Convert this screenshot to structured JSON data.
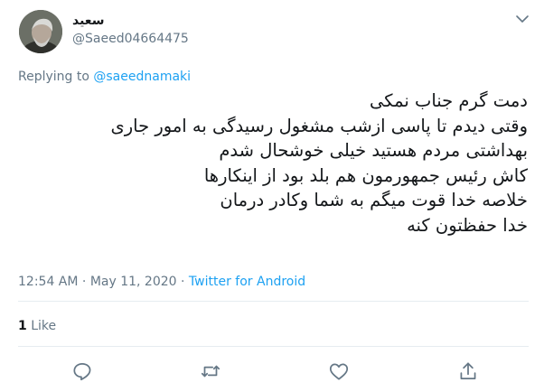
{
  "author": {
    "display_name": "سعید",
    "handle": "@Saeed04664475"
  },
  "reply": {
    "prefix": "Replying to",
    "to": "@saeednamaki"
  },
  "tweet": {
    "lines": [
      "دمت گرم جناب نمکی",
      "وقتی دیدم تا پاسی ازشب مشغول رسیدگی به امور جاری",
      "بهداشتی مردم هستید خیلی خوشحال شدم",
      "کاش رئیس جمهورمون هم بلد بود از اینکارها",
      "خلاصه خدا قوت میگم به شما وکادر درمان",
      "خدا حفظتون کنه"
    ]
  },
  "meta": {
    "time": "12:54 AM",
    "separator": "·",
    "date": "May 11, 2020",
    "source": "Twitter for Android"
  },
  "stats": {
    "likes_count": "1",
    "likes_label": "Like"
  },
  "actions": [
    {
      "icon": "reply-icon"
    },
    {
      "icon": "retweet-icon"
    },
    {
      "icon": "like-icon"
    },
    {
      "icon": "share-icon"
    }
  ],
  "colors": {
    "link": "#1da1f2",
    "muted": "#657786",
    "text": "#14171a",
    "divider": "#e6ecf0"
  }
}
